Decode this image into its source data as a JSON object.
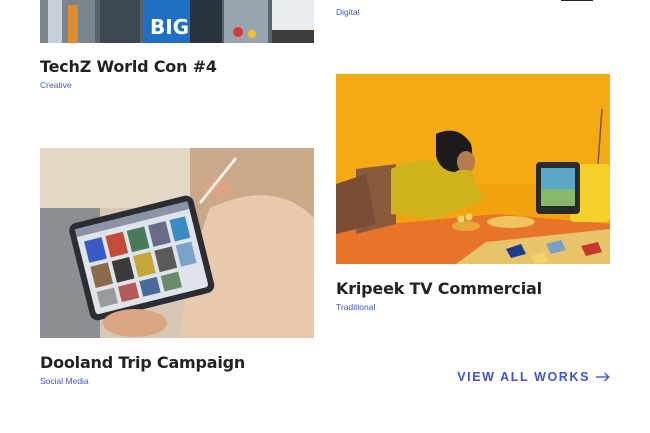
{
  "works": [
    {
      "title": "TechZ World Con #4",
      "category": "Creative",
      "thumb_text": "BIG"
    },
    {
      "title": "",
      "category": "Digital"
    },
    {
      "title": "Kripeek TV Commercial",
      "category": "Traditional"
    },
    {
      "title": "Dooland Trip Campaign",
      "category": "Social Media"
    }
  ],
  "view_all": {
    "label": "VIEW ALL WORKS",
    "icon": "arrow-right-icon"
  },
  "colors": {
    "accent": "#3a55d8",
    "title": "#222222",
    "orange_bg": "#f3a20f"
  }
}
